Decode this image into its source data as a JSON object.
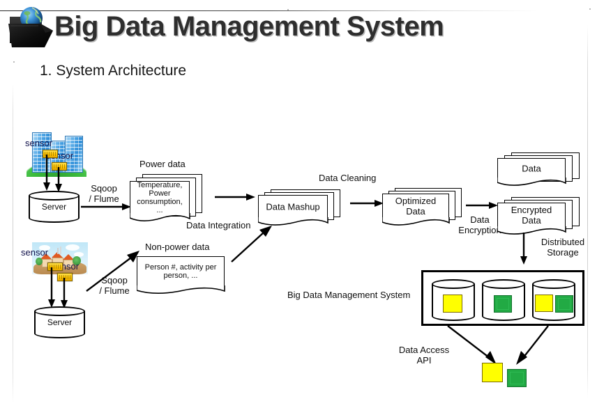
{
  "slide": {
    "title": "Big Data Management System",
    "subtitle": "1. System Architecture",
    "logo_icon": "folder-globe-icon"
  },
  "diagram": {
    "sources": [
      {
        "id": "office",
        "scene_icon": "office-buildings-icon",
        "sensor_labels": [
          "sensor",
          "sensor"
        ],
        "server_label": "Server",
        "transfer_label_line1": "Sqoop",
        "transfer_label_line2": "/ Flume"
      },
      {
        "id": "residential",
        "scene_icon": "houses-icon",
        "sensor_labels": [
          "sensor",
          "sensor"
        ],
        "server_label": "Server",
        "transfer_label_line1": "Sqoop",
        "transfer_label_line2": "/ Flume"
      }
    ],
    "documents": {
      "power_data": {
        "title": "Power data",
        "body": "Temperature, Power consumption, ..."
      },
      "non_power_data": {
        "title": "Non-power data",
        "body": "Person #, activity per person, ..."
      },
      "data_mashup": {
        "title": "Data Mashup"
      },
      "optimized_data": {
        "title": "Optimized Data"
      },
      "data_plain": {
        "title": "Data"
      },
      "encrypted_data": {
        "title": "Encrypted Data"
      }
    },
    "process_labels": {
      "data_integration": "Data Integration",
      "data_cleaning": "Data Cleaning",
      "data_encryption": "Data Encryption",
      "distributed_storage": "Distributed Storage",
      "big_data_management_system": "Big Data Management System",
      "data_access_api": "Data Access API"
    },
    "storage": {
      "cylinders": [
        {
          "id": "node-1",
          "blocks": [
            "yellow"
          ]
        },
        {
          "id": "node-2",
          "blocks": [
            "green"
          ]
        },
        {
          "id": "node-3",
          "blocks": [
            "yellow",
            "green"
          ]
        }
      ],
      "output_blocks": [
        "yellow",
        "green"
      ]
    },
    "colors": {
      "yellow_block": "#ffff00",
      "green_block": "#22aa44",
      "stroke": "#000000",
      "title_text": "#2e2e2e",
      "sensor_text": "#10104a"
    }
  }
}
